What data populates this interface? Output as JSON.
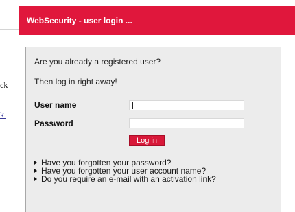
{
  "left_fragment": {
    "line1": "ck",
    "line2": "k."
  },
  "dialog": {
    "title": "WebSecurity - user login ...",
    "question1": "Are you already a registered user?",
    "question2": "Then log in right away!",
    "username_label": "User name",
    "username_value": "",
    "password_label": "Password",
    "password_value": "",
    "login_button": "Log in",
    "help_links": [
      "Have you forgotten your password?",
      "Have you forgotten your user account name?",
      "Do you require an e-mail with an activation link?"
    ]
  },
  "colors": {
    "header_red": "#e0173c",
    "button_red": "#d81839",
    "panel_gray": "#ececec"
  },
  "icons": {
    "bullet": "triangle-right-icon"
  }
}
